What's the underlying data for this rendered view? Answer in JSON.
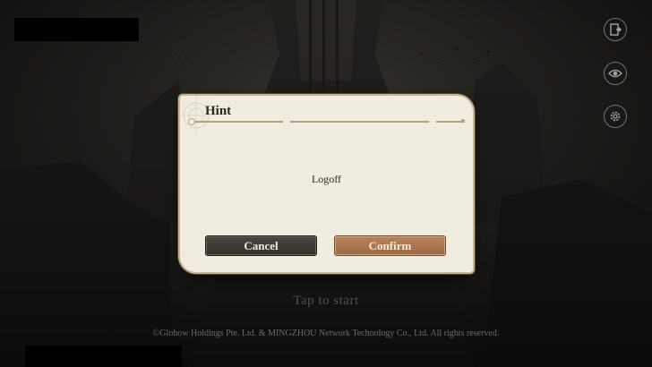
{
  "footer": {
    "tap_to_start": "Tap to start",
    "copyright": "©Glohow Holdings Pte. Ltd. & MINGZHOU Network Technology Co., Ltd. All rights reserved."
  },
  "side_buttons": {
    "exit_icon": "exit-door-icon",
    "eye_icon": "eye-icon",
    "settings_icon": "gear-icon"
  },
  "dialog": {
    "title": "Hint",
    "message": "Logoff",
    "cancel_label": "Cancel",
    "confirm_label": "Confirm"
  },
  "colors": {
    "dialog_background": "#f1ece0",
    "cancel_button": "#3f3a35",
    "confirm_button": "#ab7850",
    "accent_line": "#b5a27d"
  }
}
